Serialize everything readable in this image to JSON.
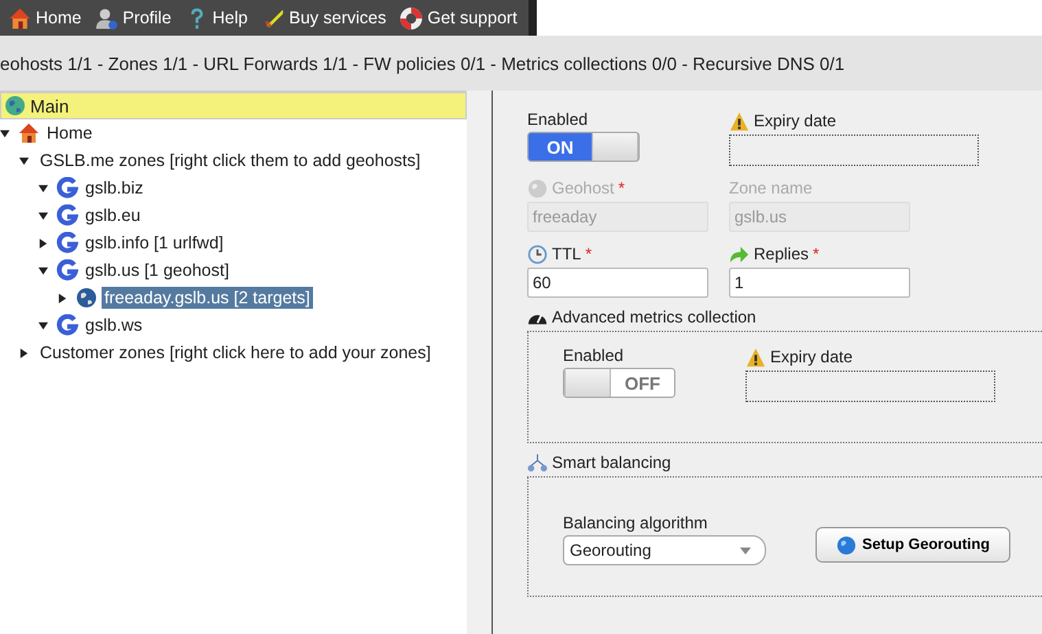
{
  "toolbar": [
    {
      "label": "Home",
      "kind": "home"
    },
    {
      "label": "Profile",
      "kind": "user"
    },
    {
      "label": "Help",
      "kind": "help"
    },
    {
      "label": "Buy services",
      "kind": "rocket"
    },
    {
      "label": "Get support",
      "kind": "lifebuoy"
    }
  ],
  "summary": "eohosts 1/1 - Zones 1/1 - URL Forwards 1/1 - FW policies 0/1 - Metrics collections 0/0 - Recursive DNS 0/1",
  "tree": {
    "header": "Main",
    "items": [
      {
        "label": "Home",
        "kind": "home",
        "expanded": true,
        "selected": false,
        "children": [
          {
            "label": "GSLB.me zones [right click them to add geohosts]",
            "expanded": true,
            "selected": false,
            "children": [
              {
                "label": "gslb.biz",
                "kind": "zone",
                "expanded": true,
                "selected": false
              },
              {
                "label": "gslb.eu",
                "kind": "zone",
                "expanded": true,
                "selected": false
              },
              {
                "label": "gslb.info [1 urlfwd]",
                "kind": "zone",
                "expanded": false,
                "selected": false
              },
              {
                "label": "gslb.us [1 geohost]",
                "kind": "zone",
                "expanded": true,
                "selected": false,
                "children": [
                  {
                    "label": "freeaday.gslb.us [2 targets]",
                    "kind": "geohost",
                    "expanded": false,
                    "selected": true
                  }
                ]
              },
              {
                "label": "gslb.ws",
                "kind": "zone",
                "expanded": true,
                "selected": false
              }
            ]
          },
          {
            "label": "Customer zones [right click here to add your zones]",
            "expanded": false,
            "selected": false
          }
        ]
      }
    ]
  },
  "form": {
    "enabled": {
      "label": "Enabled",
      "on": true,
      "text": "ON"
    },
    "expiry": {
      "label": "Expiry date"
    },
    "geohost": {
      "label": "Geohost",
      "mark": "*",
      "value": "freeaday",
      "disabled": true
    },
    "zone": {
      "label": "Zone name",
      "value": "gslb.us",
      "disabled": true
    },
    "ttl": {
      "label": "TTL",
      "mark": "*",
      "value": "60",
      "disabled": false
    },
    "replies": {
      "label": "Replies",
      "mark": "*",
      "value": "1",
      "disabled": false
    }
  },
  "metrics": {
    "title": "Advanced metrics collection",
    "enabled": {
      "label": "Enabled",
      "on": false,
      "text": "OFF"
    },
    "expiry": {
      "label": "Expiry date"
    }
  },
  "balancing": {
    "title": "Smart balancing",
    "algorithm_label": "Balancing algorithm",
    "algorithm": "Georouting",
    "button": "Setup Georouting"
  }
}
